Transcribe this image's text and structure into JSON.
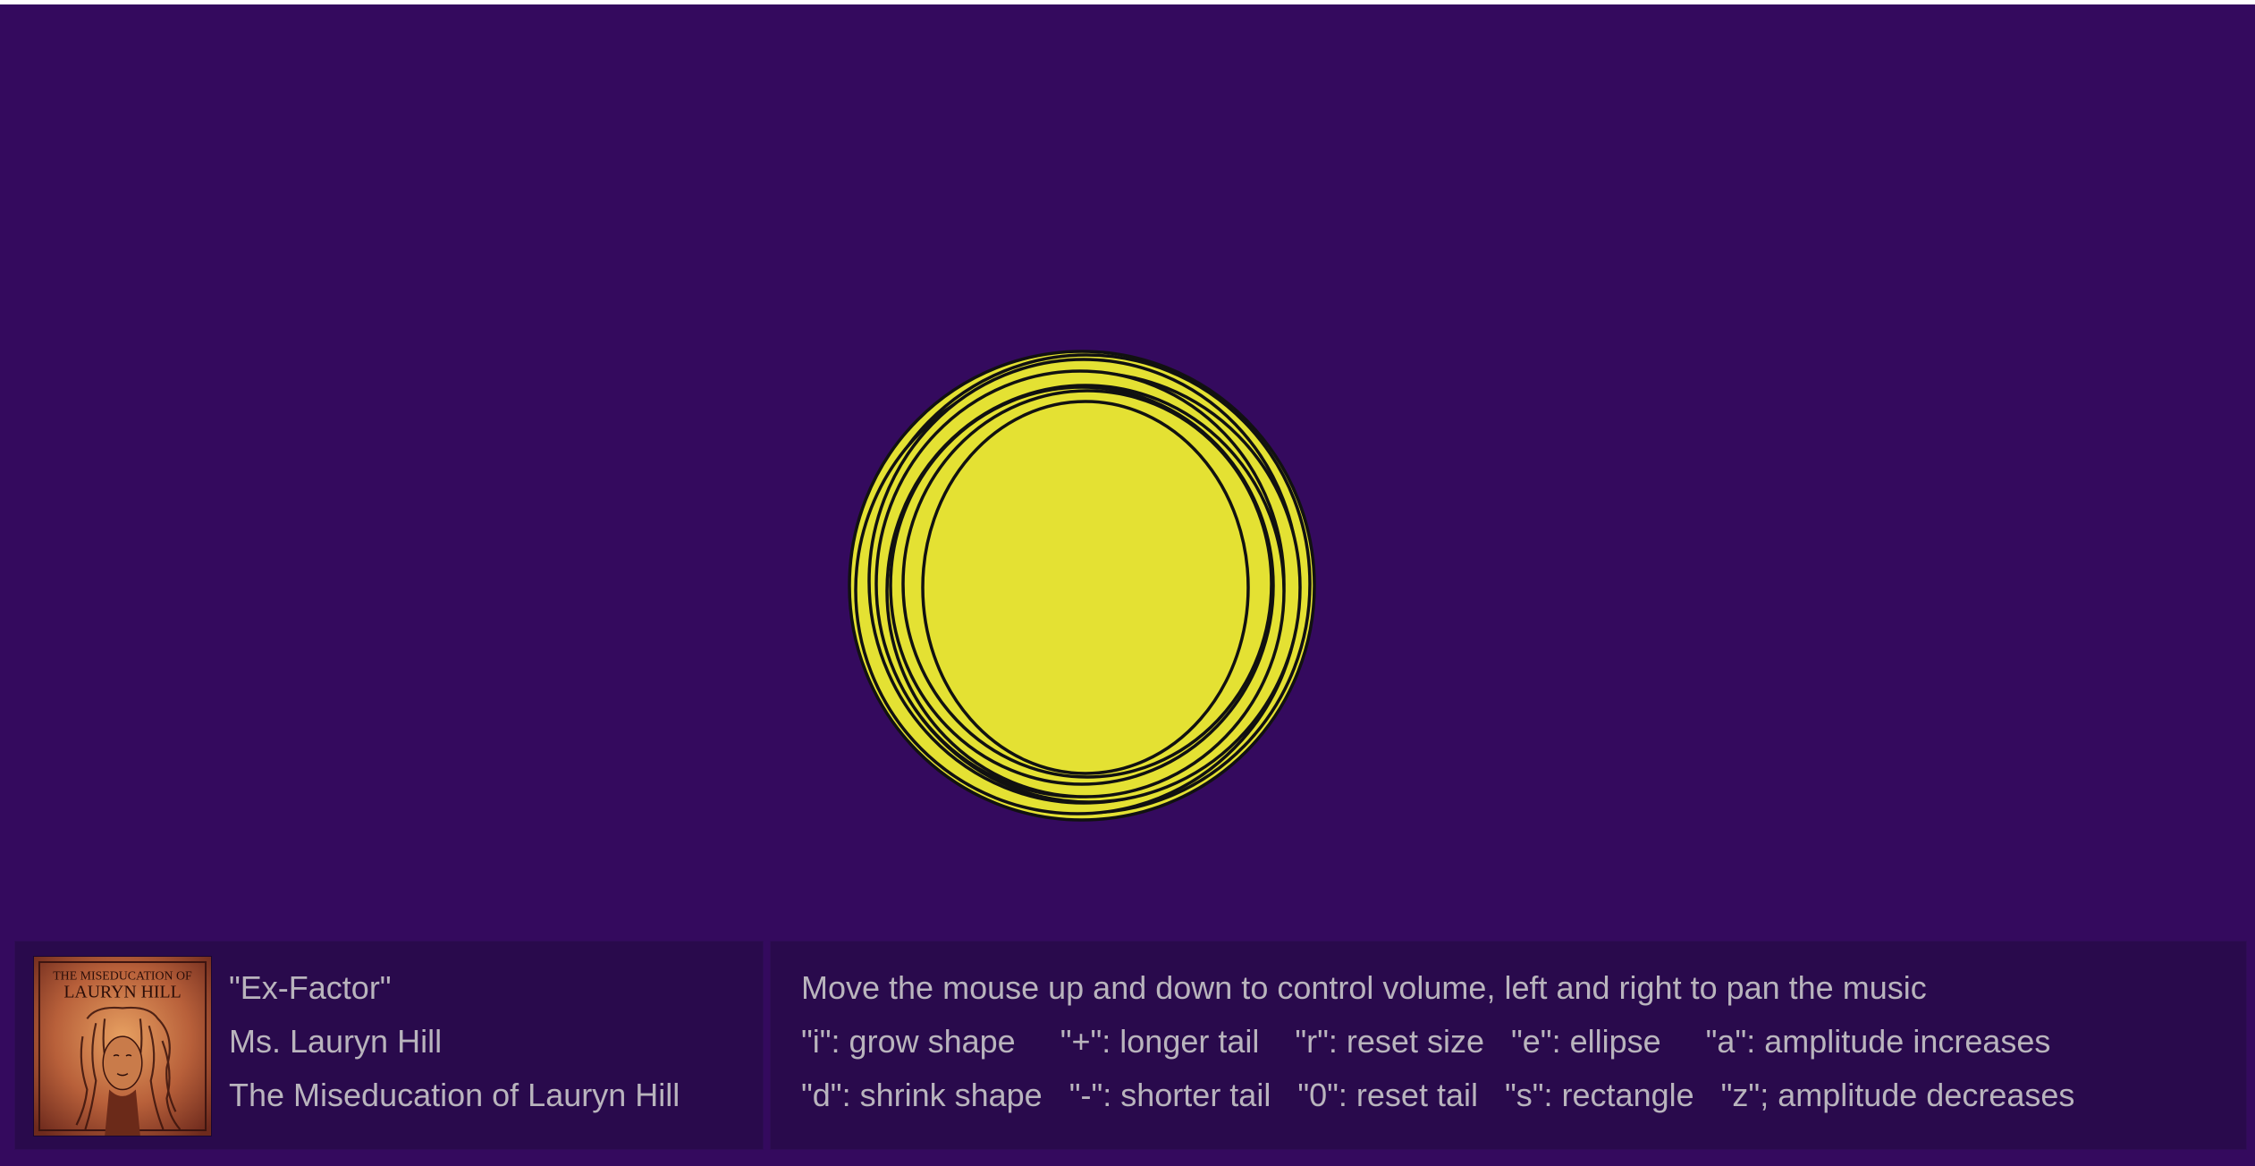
{
  "colors": {
    "background": "#340a5e",
    "panel": "#290a4c",
    "shape_fill": "#e4e133",
    "shape_stroke": "#111111",
    "text": "#b9b4bd"
  },
  "visualizer": {
    "shape": "ellipse"
  },
  "now_playing": {
    "album_art_icon": "album-cover-image",
    "album_cover_text_line1": "THE MISEDUCATION OF",
    "album_cover_text_line2": "LAURYN HILL",
    "title": "\"Ex-Factor\"",
    "artist": "Ms. Lauryn Hill",
    "album": "The Miseducation of Lauryn Hill"
  },
  "help": {
    "intro": "Move the mouse up and down to control volume, left and right to pan the music",
    "row1": "\"i\": grow shape     \"+\": longer tail    \"r\": reset size   \"e\": ellipse     \"a\": amplitude increases",
    "row2": "\"d\": shrink shape   \"-\": shorter tail   \"0\": reset tail   \"s\": rectangle   \"z\"; amplitude decreases"
  }
}
